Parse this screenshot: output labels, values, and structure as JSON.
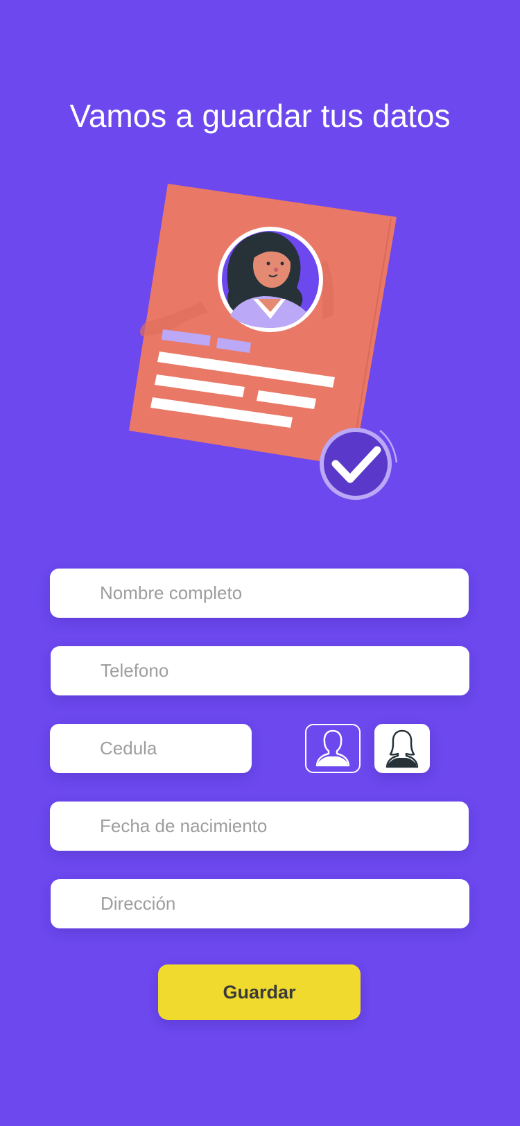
{
  "header": {
    "title": "Vamos a guardar tus datos"
  },
  "form": {
    "full_name": {
      "placeholder": "Nombre completo",
      "value": ""
    },
    "phone": {
      "placeholder": "Telefono",
      "value": ""
    },
    "id_number": {
      "placeholder": "Cedula",
      "value": ""
    },
    "birth_date": {
      "placeholder": "Fecha de nacimiento",
      "value": ""
    },
    "address": {
      "placeholder": "Dirección",
      "value": ""
    },
    "gender_options": [
      {
        "icon": "male-user-icon",
        "selected": false
      },
      {
        "icon": "female-user-icon",
        "selected": true
      }
    ],
    "save_label": "Guardar"
  },
  "colors": {
    "background": "#6c48ee",
    "card": "#ea7866",
    "accent_light": "#bba8f6",
    "check_circle": "#5a38c9",
    "button": "#f0da2e",
    "button_text": "#3a3a3a",
    "field_bg": "#ffffff",
    "placeholder": "#9d9d9d"
  }
}
